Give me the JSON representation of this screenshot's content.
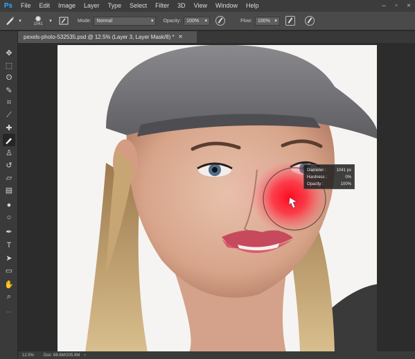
{
  "app": {
    "logo": "Ps"
  },
  "menu": {
    "items": [
      "File",
      "Edit",
      "Image",
      "Layer",
      "Type",
      "Select",
      "Filter",
      "3D",
      "View",
      "Window",
      "Help"
    ]
  },
  "options": {
    "brush_size": "1041",
    "mode_label": "Mode:",
    "mode_value": "Normal",
    "opacity_label": "Opacity:",
    "opacity_value": "100%",
    "flow_label": "Flow:",
    "flow_value": "100%"
  },
  "document": {
    "tab_title": "pexels-photo-532535.psd @ 12.5% (Layer 3, Layer Mask/8) *",
    "close": "×"
  },
  "status": {
    "zoom": "12.5%",
    "doc_info": "Doc: 68.6M/205.9M"
  },
  "hud": {
    "diameter_label": "Diameter :",
    "diameter_value": "1041 px",
    "hardness_label": "Hardness :",
    "hardness_value": "0%",
    "opacity_label": "Opacity :",
    "opacity_value": "100%"
  },
  "colors": {
    "foreground": "#000000",
    "background": "#ffffff",
    "brush_overlay": "#ff1a2e"
  },
  "icons": [
    "move-icon",
    "marquee-icon",
    "lasso-icon",
    "quick-select-icon",
    "crop-icon",
    "eyedropper-icon",
    "healing-icon",
    "brush-icon",
    "clone-stamp-icon",
    "history-brush-icon",
    "eraser-icon",
    "gradient-icon",
    "blur-icon",
    "dodge-icon",
    "pen-icon",
    "type-icon",
    "path-select-icon",
    "rectangle-icon",
    "hand-icon",
    "zoom-icon"
  ]
}
